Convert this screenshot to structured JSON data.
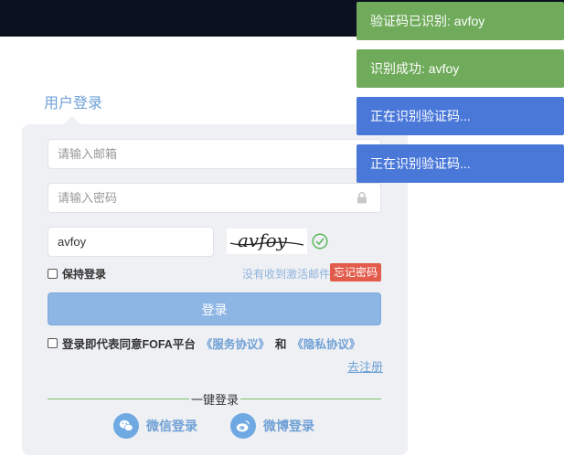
{
  "login": {
    "tab_title": "用户登录",
    "email_placeholder": "请输入邮箱",
    "password_placeholder": "请输入密码",
    "captcha_value": "avfoy",
    "captcha_image_text": "avfoy",
    "remember_label": "保持登录",
    "no_activation_link": "没有收到激活邮件",
    "forget_password": "忘记密码",
    "login_button": "登录",
    "agree_text": "登录即代表同意FOFA平台",
    "service_agreement": "《服务协议》",
    "and_text": "和",
    "privacy_agreement": "《隐私协议》",
    "register_link": "去注册",
    "one_click_login": "一键登录",
    "wechat_login": "微信登录",
    "weibo_login": "微博登录"
  },
  "toasts": [
    {
      "text": "验证码已识别: avfoy",
      "color": "#6fab5b"
    },
    {
      "text": "识别成功: avfoy",
      "color": "#6fab5b"
    },
    {
      "text": "正在识别验证码...",
      "color": "#4a78d9"
    },
    {
      "text": "正在识别验证码...",
      "color": "#4a78d9"
    }
  ],
  "colors": {
    "accent": "#6fa0d6",
    "danger": "#e25b4b",
    "success": "#6fab5b",
    "info": "#4a78d9",
    "header": "#0b1120"
  }
}
